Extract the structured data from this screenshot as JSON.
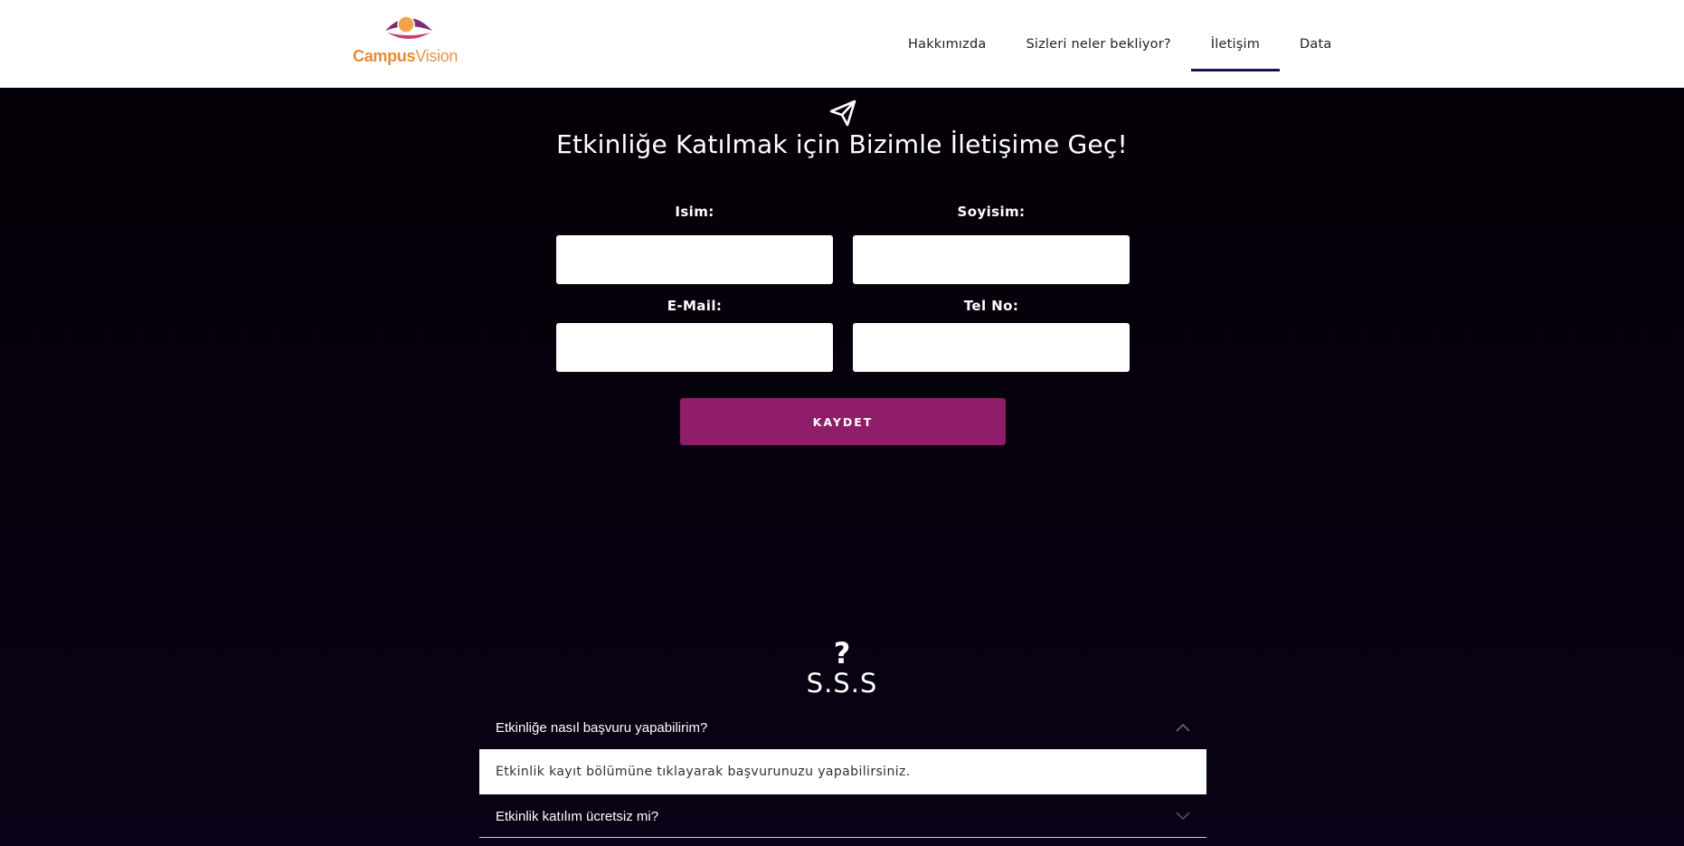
{
  "header": {
    "logo": {
      "part1": "Campus",
      "part2": "Vision"
    },
    "nav": [
      {
        "label": "Hakkımızda"
      },
      {
        "label": "Sizleri neler bekliyor?"
      },
      {
        "label": "İletişim",
        "active": true
      },
      {
        "label": "Data"
      }
    ]
  },
  "contact": {
    "icon": "paper-plane-icon",
    "title": "Etkinliğe Katılmak için Bizimle İletişime Geç!",
    "fields": {
      "first_name": {
        "label": "Isim:",
        "value": ""
      },
      "last_name": {
        "label": "Soyisim:",
        "value": ""
      },
      "email": {
        "label": "E-Mail:",
        "value": ""
      },
      "phone": {
        "label": "Tel No:",
        "value": ""
      }
    },
    "submit_label": "KAYDET"
  },
  "faq": {
    "icon": "?",
    "title": "S.S.S",
    "items": [
      {
        "question": "Etkinliğe nasıl başvuru yapabilirim?",
        "answer": "Etkinlik kayıt bölümüne tıklayarak başvurunuzu yapabilirsiniz.",
        "expanded": true
      },
      {
        "question": "Etkinlik katılım ücretsiz mi?",
        "expanded": false
      }
    ]
  },
  "colors": {
    "background": "#050007",
    "accent_button": "#8f1d69",
    "nav_active_underline": "#1b0f5a",
    "logo_orange": "#e58a35",
    "logo_purple": "#7b2a7a"
  }
}
